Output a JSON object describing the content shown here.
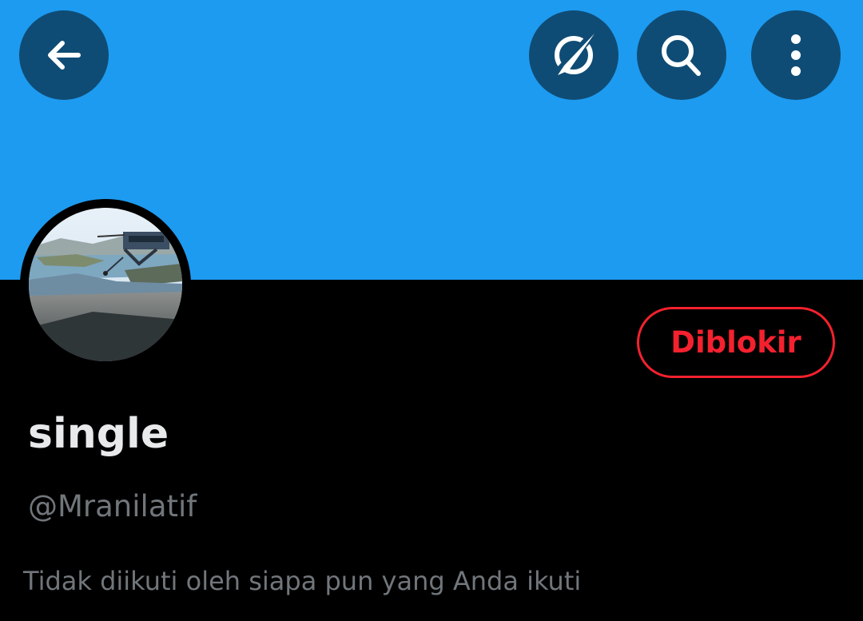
{
  "header": {
    "banner_color": "#1D9BF0",
    "icons": {
      "back": "arrow-left-icon",
      "discovery": "compass-slash-icon",
      "search": "search-icon",
      "more": "more-vertical-icon"
    }
  },
  "profile": {
    "display_name": "single",
    "handle": "@Mranilatif",
    "followers_note": "Tidak diikuti oleh siapa pun yang Anda ikuti",
    "blocked_label": "Diblokir",
    "blocked_color": "#F4212E"
  }
}
